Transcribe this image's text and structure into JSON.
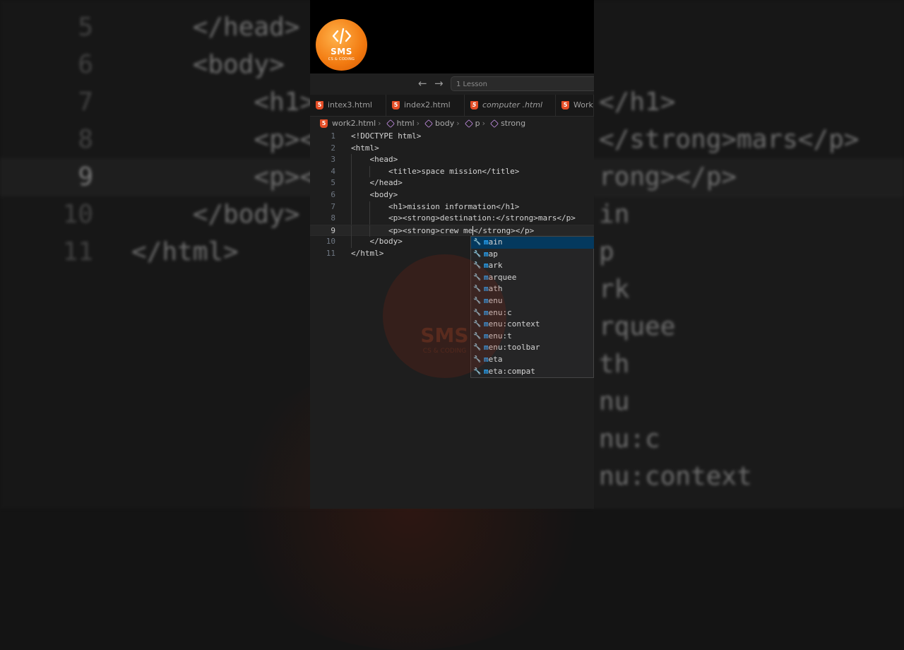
{
  "logo": {
    "name": "SMS",
    "tagline": "CS & CODING"
  },
  "titlebar": {
    "back_icon": "←",
    "forward_icon": "→",
    "search_text": "1 Lesson"
  },
  "tabs": [
    {
      "label": "intex3.html"
    },
    {
      "label": "index2.html"
    },
    {
      "label": "computer .html"
    },
    {
      "label": "Work"
    }
  ],
  "breadcrumb": {
    "file": "work2.html",
    "items": [
      "html",
      "body",
      "p",
      "strong"
    ]
  },
  "editor": {
    "lines": [
      {
        "n": "1",
        "text": "<!DOCTYPE html>"
      },
      {
        "n": "2",
        "text": "<html>"
      },
      {
        "n": "3",
        "text": "    <head>"
      },
      {
        "n": "4",
        "text": "        <title>space mission</title>"
      },
      {
        "n": "5",
        "text": "    </head>"
      },
      {
        "n": "6",
        "text": "    <body>"
      },
      {
        "n": "7",
        "text": "        <h1>mission information</h1>"
      },
      {
        "n": "8",
        "text": "        <p><strong>destination:</strong>mars</p>"
      },
      {
        "n": "9",
        "text_before": "        <p><strong>crew me",
        "text_after": "</strong></p>"
      },
      {
        "n": "10",
        "text": "    </body>"
      },
      {
        "n": "11",
        "text": "</html>"
      }
    ]
  },
  "suggestions": [
    {
      "match": "m",
      "rest": "ain"
    },
    {
      "match": "m",
      "rest": "ap"
    },
    {
      "match": "m",
      "rest": "ark"
    },
    {
      "match": "m",
      "rest": "arquee"
    },
    {
      "match": "m",
      "rest": "ath"
    },
    {
      "match": "m",
      "rest": "enu"
    },
    {
      "match": "m",
      "rest": "enu:c"
    },
    {
      "match": "m",
      "rest": "enu:context"
    },
    {
      "match": "m",
      "rest": "enu:t"
    },
    {
      "match": "m",
      "rest": "enu:toolbar"
    },
    {
      "match": "m",
      "rest": "eta"
    },
    {
      "match": "m",
      "rest": "eta:compat"
    }
  ],
  "background": {
    "left_lines": [
      {
        "n": "5",
        "text": "    </head>"
      },
      {
        "n": "6",
        "text": "    <body>"
      },
      {
        "n": "7",
        "text": "        <h1>"
      },
      {
        "n": "8",
        "text": "        <p><"
      },
      {
        "n": "9",
        "text": "        <p><"
      },
      {
        "n": "10",
        "text": "    </body>"
      },
      {
        "n": "11",
        "text": "</html>"
      }
    ],
    "right_lines": [
      "</h1>",
      "</strong>mars</p>",
      "rong></p>",
      "in",
      "p",
      "rk",
      "rquee",
      "th",
      "nu",
      "nu:c",
      "nu:context"
    ]
  },
  "colors": {
    "accent": "#2aaaff",
    "html_icon": "#e44d26",
    "selection": "#04395e",
    "logo_orange": "#f27a10"
  }
}
